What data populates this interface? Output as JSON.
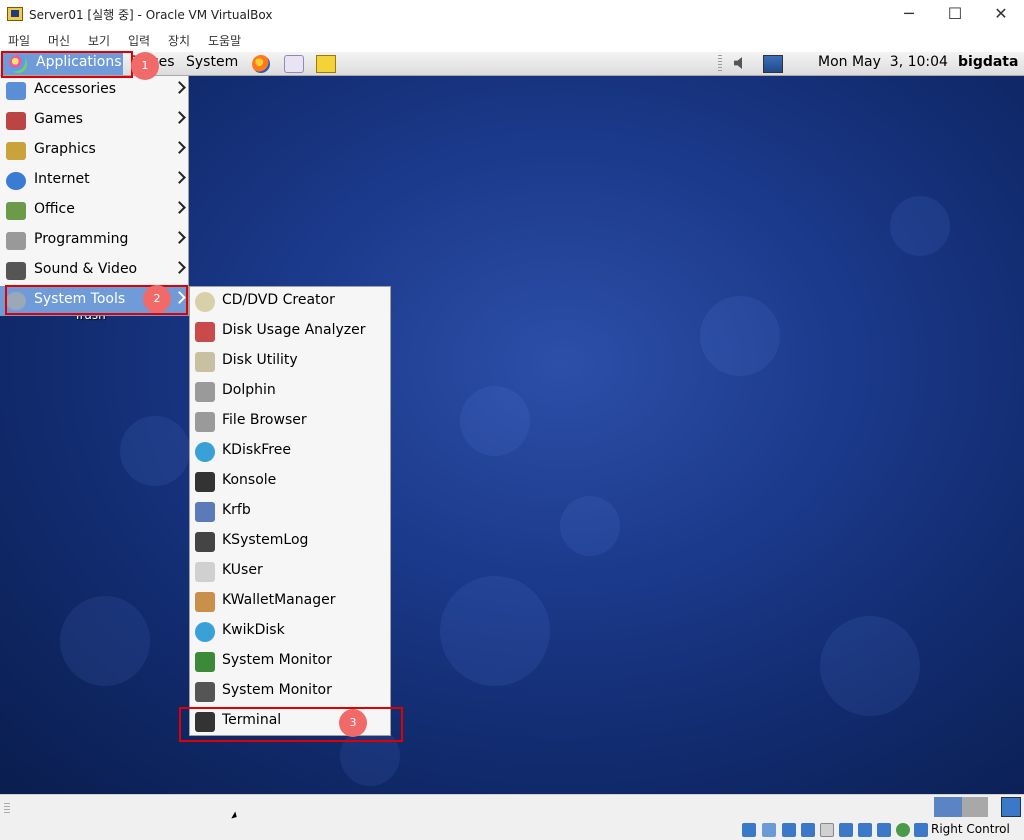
{
  "window": {
    "title": "Server01 [실행 중] - Oracle VM VirtualBox",
    "controls": {
      "minimize": "─",
      "maximize": "☐",
      "close": "✕"
    }
  },
  "vbox_menu": [
    "파일",
    "머신",
    "보기",
    "입력",
    "장치",
    "도움말"
  ],
  "panel": {
    "applications": "Applications",
    "places": "Places",
    "system": "System",
    "clock": "Mon May  3, 10:04",
    "user": "bigdata"
  },
  "desktop": {
    "trash_label": "Trash"
  },
  "apps_menu": {
    "items": [
      {
        "label": "Accessories",
        "icon": "accessories-icon",
        "color": "#5a8fd6"
      },
      {
        "label": "Games",
        "icon": "games-icon",
        "color": "#b44"
      },
      {
        "label": "Graphics",
        "icon": "graphics-icon",
        "color": "#c8a23a"
      },
      {
        "label": "Internet",
        "icon": "internet-icon",
        "color": "#3a7bd5"
      },
      {
        "label": "Office",
        "icon": "office-icon",
        "color": "#6a9a4a"
      },
      {
        "label": "Programming",
        "icon": "programming-icon",
        "color": "#999"
      },
      {
        "label": "Sound & Video",
        "icon": "sound-video-icon",
        "color": "#555"
      },
      {
        "label": "System Tools",
        "icon": "system-tools-icon",
        "color": "#9aa8b8"
      }
    ]
  },
  "system_tools_menu": {
    "items": [
      {
        "label": "CD/DVD Creator",
        "icon": "cd-dvd-icon",
        "color": "#d8d0a8"
      },
      {
        "label": "Disk Usage Analyzer",
        "icon": "disk-usage-icon",
        "color": "#c84a4a"
      },
      {
        "label": "Disk Utility",
        "icon": "disk-utility-icon",
        "color": "#c8c0a0"
      },
      {
        "label": "Dolphin",
        "icon": "dolphin-icon",
        "color": "#9a9a9a"
      },
      {
        "label": "File Browser",
        "icon": "file-browser-icon",
        "color": "#9a9a9a"
      },
      {
        "label": "KDiskFree",
        "icon": "kdiskfree-icon",
        "color": "#3aa0d8"
      },
      {
        "label": "Konsole",
        "icon": "konsole-icon",
        "color": "#333"
      },
      {
        "label": "Krfb",
        "icon": "krfb-icon",
        "color": "#5a7ab8"
      },
      {
        "label": "KSystemLog",
        "icon": "ksystemlog-icon",
        "color": "#444"
      },
      {
        "label": "KUser",
        "icon": "kuser-icon",
        "color": "#d0d0d0"
      },
      {
        "label": "KWalletManager",
        "icon": "kwallet-icon",
        "color": "#c89048"
      },
      {
        "label": "KwikDisk",
        "icon": "kwikdisk-icon",
        "color": "#3aa0d8"
      },
      {
        "label": "System Monitor",
        "icon": "system-monitor-icon",
        "color": "#3a8a3a"
      },
      {
        "label": "System Monitor",
        "icon": "system-monitor-icon",
        "color": "#555"
      },
      {
        "label": "Terminal",
        "icon": "terminal-icon",
        "color": "#333"
      }
    ]
  },
  "annotations": {
    "step1": "1",
    "step2": "2",
    "step3": "3"
  },
  "status": {
    "host_key": "Right Control"
  }
}
